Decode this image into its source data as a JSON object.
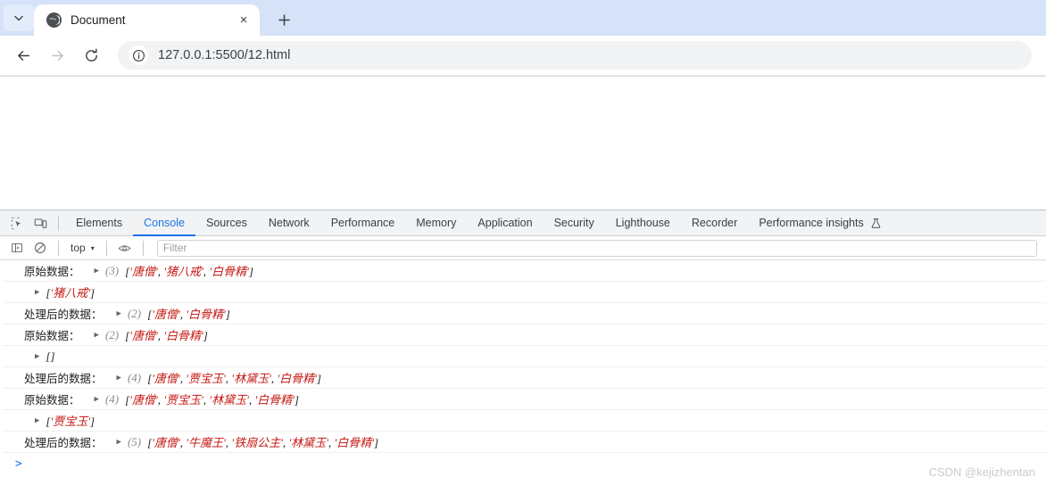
{
  "browser": {
    "tab": {
      "title": "Document",
      "favicon": "globe-icon",
      "close_label": "×"
    },
    "tab_menu_icon": "chevron-down-icon",
    "new_tab_label": "+",
    "nav": {
      "back": "←",
      "forward": "→",
      "reload": "⟳"
    },
    "omnibox": {
      "url": "127.0.0.1:5500/12.html",
      "info_icon": "info-circle-icon"
    }
  },
  "devtools": {
    "left_icons": [
      "inspect-element-icon",
      "device-toolbar-icon"
    ],
    "tabs": [
      {
        "label": "Elements",
        "active": false
      },
      {
        "label": "Console",
        "active": true
      },
      {
        "label": "Sources",
        "active": false
      },
      {
        "label": "Network",
        "active": false
      },
      {
        "label": "Performance",
        "active": false
      },
      {
        "label": "Memory",
        "active": false
      },
      {
        "label": "Application",
        "active": false
      },
      {
        "label": "Security",
        "active": false
      },
      {
        "label": "Lighthouse",
        "active": false
      },
      {
        "label": "Recorder",
        "active": false
      },
      {
        "label": "Performance insights",
        "active": false,
        "icon": "beaker-icon"
      }
    ],
    "toolbar": {
      "sidebar_icon": "console-sidebar-icon",
      "clear_icon": "clear-console-icon",
      "context": "top",
      "context_caret": "▾",
      "eye_icon": "live-expression-eye-icon",
      "filter_placeholder": "Filter"
    },
    "accent_color": "#1a73e8",
    "string_color": "#c41a16",
    "prompt": ">"
  },
  "console_rows": [
    {
      "label": "原始数据：",
      "count": "(3)",
      "items": [
        "'唐僧'",
        "'猪八戒'",
        "'白骨精'"
      ],
      "sub": false
    },
    {
      "label": "",
      "count": "",
      "items": [
        "'猪八戒'"
      ],
      "sub": true
    },
    {
      "label": "处理后的数据：",
      "count": "(2)",
      "items": [
        "'唐僧'",
        "'白骨精'"
      ],
      "sub": false
    },
    {
      "label": "原始数据：",
      "count": "(2)",
      "items": [
        "'唐僧'",
        "'白骨精'"
      ],
      "sub": false
    },
    {
      "label": "",
      "count": "",
      "items": [],
      "sub": true
    },
    {
      "label": "处理后的数据：",
      "count": "(4)",
      "items": [
        "'唐僧'",
        "'贾宝玉'",
        "'林黛玉'",
        "'白骨精'"
      ],
      "sub": false
    },
    {
      "label": "原始数据：",
      "count": "(4)",
      "items": [
        "'唐僧'",
        "'贾宝玉'",
        "'林黛玉'",
        "'白骨精'"
      ],
      "sub": false
    },
    {
      "label": "",
      "count": "",
      "items": [
        "'贾宝玉'"
      ],
      "sub": true
    },
    {
      "label": "处理后的数据：",
      "count": "(5)",
      "items": [
        "'唐僧'",
        "'牛魔王'",
        "'铁扇公主'",
        "'林黛玉'",
        "'白骨精'"
      ],
      "sub": false
    }
  ],
  "watermark": "CSDN @kejizhentan"
}
